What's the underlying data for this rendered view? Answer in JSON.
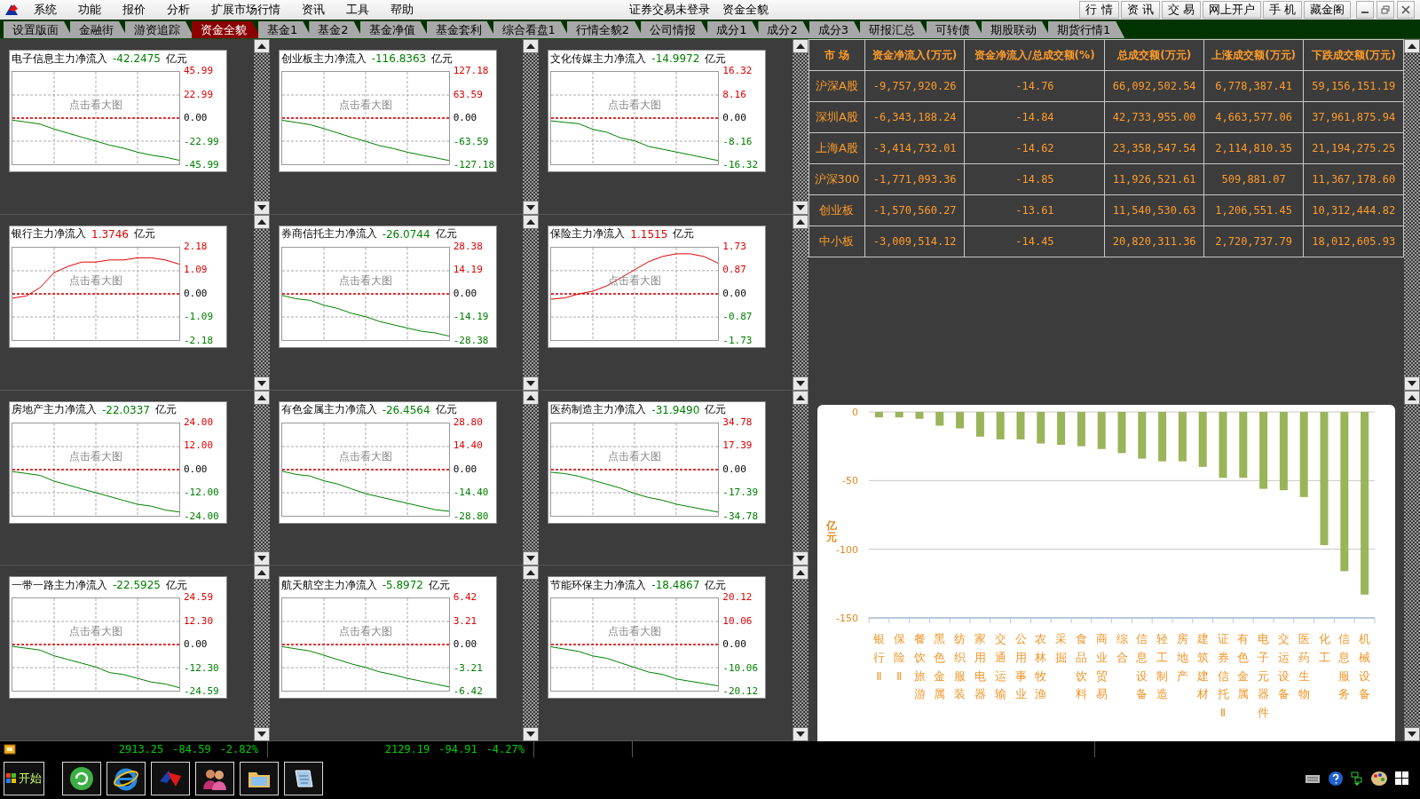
{
  "menu_bar": {
    "items": [
      "系统",
      "功能",
      "报价",
      "分析",
      "扩展市场行情",
      "资讯",
      "工具",
      "帮助"
    ],
    "login_status": "证券交易未登录",
    "page_title": "资金全貌",
    "quick_buttons": [
      "行 情",
      "资 讯",
      "交 易",
      "网上开户",
      "手 机",
      "藏金阁"
    ]
  },
  "tabs": [
    {
      "label": "设置版面",
      "selected": false
    },
    {
      "label": "金融街",
      "selected": false
    },
    {
      "label": "游资追踪",
      "selected": false
    },
    {
      "label": "资金全貌",
      "selected": true
    },
    {
      "label": "基金1",
      "selected": false
    },
    {
      "label": "基金2",
      "selected": false
    },
    {
      "label": "基金净值",
      "selected": false
    },
    {
      "label": "基金套利",
      "selected": false
    },
    {
      "label": "综合看盘1",
      "selected": false
    },
    {
      "label": "行情全貌2",
      "selected": false
    },
    {
      "label": "公司情报",
      "selected": false
    },
    {
      "label": "成分1",
      "selected": false
    },
    {
      "label": "成分2",
      "selected": false
    },
    {
      "label": "成分3",
      "selected": false
    },
    {
      "label": "研报汇总",
      "selected": false
    },
    {
      "label": "可转债",
      "selected": false
    },
    {
      "label": "期股联动",
      "selected": false
    },
    {
      "label": "期货行情1",
      "selected": false
    }
  ],
  "sector_charts": [
    {
      "title": "电子信息主力净流入",
      "value": "-42.2475",
      "unit": "亿元",
      "hint": "点击看大图",
      "chart_data": {
        "type": "line",
        "grid": true,
        "ylim": [
          -45.99,
          45.99
        ],
        "ref_lines": [
          {
            "axis": "y",
            "value": 0,
            "color": "#e00000"
          }
        ],
        "yticks": [
          {
            "value": 45.99,
            "label": "45.99"
          },
          {
            "value": 22.99,
            "label": "22.99"
          },
          {
            "value": 0,
            "label": "0.00"
          },
          {
            "value": -22.99,
            "label": "-22.99"
          },
          {
            "value": -45.99,
            "label": "-45.99"
          }
        ],
        "series": [
          {
            "color": "#008000",
            "values": [
              -2,
              -4,
              -6,
              -11,
              -15,
              -19,
              -23,
              -27,
              -30,
              -34,
              -37,
              -39,
              -42
            ]
          }
        ]
      }
    },
    {
      "title": "创业板主力净流入",
      "value": "-116.8363",
      "unit": "亿元",
      "hint": "点击看大图",
      "chart_data": {
        "type": "line",
        "grid": true,
        "ylim": [
          -127.18,
          127.18
        ],
        "ref_lines": [
          {
            "axis": "y",
            "value": 0,
            "color": "#e00000"
          }
        ],
        "yticks": [
          {
            "value": 127.18,
            "label": "127.18"
          },
          {
            "value": 63.59,
            "label": "63.59"
          },
          {
            "value": 0,
            "label": "0.00"
          },
          {
            "value": -63.59,
            "label": "-63.59"
          },
          {
            "value": -127.18,
            "label": "-127.18"
          }
        ],
        "series": [
          {
            "color": "#008000",
            "values": [
              -6,
              -12,
              -18,
              -29,
              -41,
              -53,
              -64,
              -76,
              -84,
              -94,
              -102,
              -109,
              -117
            ]
          }
        ]
      }
    },
    {
      "title": "文化传媒主力净流入",
      "value": "-14.9972",
      "unit": "亿元",
      "hint": "点击看大图",
      "chart_data": {
        "type": "line",
        "grid": true,
        "ylim": [
          -16.32,
          16.32
        ],
        "ref_lines": [
          {
            "axis": "y",
            "value": 0,
            "color": "#e00000"
          }
        ],
        "yticks": [
          {
            "value": 16.32,
            "label": "16.32"
          },
          {
            "value": 8.16,
            "label": "8.16"
          },
          {
            "value": 0,
            "label": "0.00"
          },
          {
            "value": -8.16,
            "label": "-8.16"
          },
          {
            "value": -16.32,
            "label": "-16.32"
          }
        ],
        "series": [
          {
            "color": "#008000",
            "values": [
              -1,
              -1.5,
              -2,
              -4,
              -5,
              -7,
              -8,
              -10,
              -11,
              -12,
              -13,
              -14,
              -15
            ]
          }
        ]
      }
    },
    {
      "title": "银行主力净流入",
      "value": "1.3746",
      "unit": "亿元",
      "hint": "点击看大图",
      "chart_data": {
        "type": "line",
        "grid": true,
        "ylim": [
          -2.18,
          2.18
        ],
        "ref_lines": [
          {
            "axis": "y",
            "value": 0,
            "color": "#e00000"
          }
        ],
        "yticks": [
          {
            "value": 2.18,
            "label": "2.18"
          },
          {
            "value": 1.09,
            "label": "1.09"
          },
          {
            "value": 0,
            "label": "0.00"
          },
          {
            "value": -1.09,
            "label": "-1.09"
          },
          {
            "value": -2.18,
            "label": "-2.18"
          }
        ],
        "series": [
          {
            "color": "#e00000",
            "values": [
              -0.2,
              -0.1,
              0.3,
              1.0,
              1.3,
              1.5,
              1.5,
              1.6,
              1.6,
              1.7,
              1.7,
              1.6,
              1.4
            ]
          }
        ]
      }
    },
    {
      "title": "券商信托主力净流入",
      "value": "-26.0744",
      "unit": "亿元",
      "hint": "点击看大图",
      "chart_data": {
        "type": "line",
        "grid": true,
        "ylim": [
          -28.38,
          28.38
        ],
        "ref_lines": [
          {
            "axis": "y",
            "value": 0,
            "color": "#e00000"
          }
        ],
        "yticks": [
          {
            "value": 28.38,
            "label": "28.38"
          },
          {
            "value": 14.19,
            "label": "14.19"
          },
          {
            "value": 0,
            "label": "0.00"
          },
          {
            "value": -14.19,
            "label": "-14.19"
          },
          {
            "value": -28.38,
            "label": "-28.38"
          }
        ],
        "series": [
          {
            "color": "#008000",
            "values": [
              -1,
              -3,
              -4,
              -7,
              -9,
              -12,
              -14,
              -17,
              -19,
              -21,
              -23,
              -24,
              -26
            ]
          }
        ]
      }
    },
    {
      "title": "保险主力净流入",
      "value": "1.1515",
      "unit": "亿元",
      "hint": "点击看大图",
      "chart_data": {
        "type": "line",
        "grid": true,
        "ylim": [
          -1.73,
          1.73
        ],
        "ref_lines": [
          {
            "axis": "y",
            "value": 0,
            "color": "#e00000"
          }
        ],
        "yticks": [
          {
            "value": 1.73,
            "label": "1.73"
          },
          {
            "value": 0.87,
            "label": "0.87"
          },
          {
            "value": 0,
            "label": "0.00"
          },
          {
            "value": -0.87,
            "label": "-0.87"
          },
          {
            "value": -1.73,
            "label": "-1.73"
          }
        ],
        "series": [
          {
            "color": "#e00000",
            "values": [
              -0.2,
              -0.15,
              0.0,
              0.1,
              0.3,
              0.6,
              0.9,
              1.2,
              1.4,
              1.5,
              1.5,
              1.4,
              1.15
            ]
          }
        ]
      }
    },
    {
      "title": "房地产主力净流入",
      "value": "-22.0337",
      "unit": "亿元",
      "hint": "点击看大图",
      "chart_data": {
        "type": "line",
        "grid": true,
        "ylim": [
          -24,
          24
        ],
        "ref_lines": [
          {
            "axis": "y",
            "value": 0,
            "color": "#e00000"
          }
        ],
        "yticks": [
          {
            "value": 24,
            "label": "24.00"
          },
          {
            "value": 12,
            "label": "12.00"
          },
          {
            "value": 0,
            "label": "0.00"
          },
          {
            "value": -12,
            "label": "-12.00"
          },
          {
            "value": -24,
            "label": "-24.00"
          }
        ],
        "series": [
          {
            "color": "#008000",
            "values": [
              -1,
              -2,
              -3,
              -6,
              -8,
              -10,
              -12,
              -14,
              -16,
              -18,
              -19,
              -21,
              -22
            ]
          }
        ]
      }
    },
    {
      "title": "有色金属主力净流入",
      "value": "-26.4564",
      "unit": "亿元",
      "hint": "点击看大图",
      "chart_data": {
        "type": "line",
        "grid": true,
        "ylim": [
          -28.8,
          28.8
        ],
        "ref_lines": [
          {
            "axis": "y",
            "value": 0,
            "color": "#e00000"
          }
        ],
        "yticks": [
          {
            "value": 28.8,
            "label": "28.80"
          },
          {
            "value": 14.4,
            "label": "14.40"
          },
          {
            "value": 0,
            "label": "0.00"
          },
          {
            "value": -14.4,
            "label": "-14.40"
          },
          {
            "value": -28.8,
            "label": "-28.80"
          }
        ],
        "series": [
          {
            "color": "#008000",
            "values": [
              -1,
              -3,
              -4,
              -7,
              -9,
              -12,
              -15,
              -17,
              -19,
              -21,
              -23,
              -25,
              -26
            ]
          }
        ]
      }
    },
    {
      "title": "医药制造主力净流入",
      "value": "-31.9490",
      "unit": "亿元",
      "hint": "点击看大图",
      "chart_data": {
        "type": "line",
        "grid": true,
        "ylim": [
          -34.78,
          34.78
        ],
        "ref_lines": [
          {
            "axis": "y",
            "value": 0,
            "color": "#e00000"
          }
        ],
        "yticks": [
          {
            "value": 34.78,
            "label": "34.78"
          },
          {
            "value": 17.39,
            "label": "17.39"
          },
          {
            "value": 0,
            "label": "0.00"
          },
          {
            "value": -17.39,
            "label": "-17.39"
          },
          {
            "value": -34.78,
            "label": "-34.78"
          }
        ],
        "series": [
          {
            "color": "#008000",
            "values": [
              -2,
              -3,
              -5,
              -8,
              -11,
              -14,
              -18,
              -21,
              -23,
              -26,
              -28,
              -30,
              -32
            ]
          }
        ]
      }
    },
    {
      "title": "一带一路主力净流入",
      "value": "-22.5925",
      "unit": "亿元",
      "hint": "点击看大图",
      "chart_data": {
        "type": "line",
        "grid": true,
        "ylim": [
          -24.59,
          24.59
        ],
        "ref_lines": [
          {
            "axis": "y",
            "value": 0,
            "color": "#e00000"
          }
        ],
        "yticks": [
          {
            "value": 24.59,
            "label": "24.59"
          },
          {
            "value": 12.3,
            "label": "12.30"
          },
          {
            "value": 0,
            "label": "0.00"
          },
          {
            "value": -12.3,
            "label": "-12.30"
          },
          {
            "value": -24.59,
            "label": "-24.59"
          }
        ],
        "series": [
          {
            "color": "#008000",
            "values": [
              -1,
              -2,
              -3,
              -6,
              -8,
              -10,
              -12,
              -15,
              -16,
              -18,
              -20,
              -21,
              -23
            ]
          }
        ]
      }
    },
    {
      "title": "航天航空主力净流入",
      "value": "-5.8972",
      "unit": "亿元",
      "hint": "点击看大图",
      "chart_data": {
        "type": "line",
        "grid": true,
        "ylim": [
          -6.42,
          6.42
        ],
        "ref_lines": [
          {
            "axis": "y",
            "value": 0,
            "color": "#e00000"
          }
        ],
        "yticks": [
          {
            "value": 6.42,
            "label": "6.42"
          },
          {
            "value": 3.21,
            "label": "3.21"
          },
          {
            "value": 0,
            "label": "0.00"
          },
          {
            "value": -3.21,
            "label": "-3.21"
          },
          {
            "value": -6.42,
            "label": "-6.42"
          }
        ],
        "series": [
          {
            "color": "#008000",
            "values": [
              -0.3,
              -0.6,
              -0.9,
              -1.5,
              -2.1,
              -2.7,
              -3.2,
              -3.8,
              -4.2,
              -4.7,
              -5.1,
              -5.5,
              -5.9
            ]
          }
        ]
      }
    },
    {
      "title": "节能环保主力净流入",
      "value": "-18.4867",
      "unit": "亿元",
      "hint": "点击看大图",
      "chart_data": {
        "type": "line",
        "grid": true,
        "ylim": [
          -20.12,
          20.12
        ],
        "ref_lines": [
          {
            "axis": "y",
            "value": 0,
            "color": "#e00000"
          }
        ],
        "yticks": [
          {
            "value": 20.12,
            "label": "20.12"
          },
          {
            "value": 10.06,
            "label": "10.06"
          },
          {
            "value": 0,
            "label": "0.00"
          },
          {
            "value": -10.06,
            "label": "-10.06"
          },
          {
            "value": -20.12,
            "label": "-20.12"
          }
        ],
        "series": [
          {
            "color": "#008000",
            "values": [
              -1,
              -2,
              -3,
              -5,
              -6,
              -8,
              -10,
              -12,
              -13,
              -15,
              -16,
              -17,
              -18
            ]
          }
        ]
      }
    }
  ],
  "market_table": {
    "columns": [
      "市 场",
      "资金净流入(万元)",
      "资金净流入/总成交额(%)",
      "总成交额(万元)",
      "上涨成交额(万元)",
      "下跌成交额(万元)"
    ],
    "rows": [
      [
        "沪深A股",
        "-9,757,920.26",
        "-14.76",
        "66,092,502.54",
        "6,778,387.41",
        "59,156,151.19"
      ],
      [
        "深圳A股",
        "-6,343,188.24",
        "-14.84",
        "42,733,955.00",
        "4,663,577.06",
        "37,961,875.94"
      ],
      [
        "上海A股",
        "-3,414,732.01",
        "-14.62",
        "23,358,547.54",
        "2,114,810.35",
        "21,194,275.25"
      ],
      [
        "沪深300",
        "-1,771,093.36",
        "-14.85",
        "11,926,521.61",
        "509,881.07",
        "11,367,178.60"
      ],
      [
        "创业板",
        "-1,570,560.27",
        "-13.61",
        "11,540,530.63",
        "1,206,551.45",
        "10,312,444.82"
      ],
      [
        "中小板",
        "-3,009,514.12",
        "-14.45",
        "20,820,311.36",
        "2,720,737.79",
        "18,012,605.93"
      ]
    ]
  },
  "industry_chart": {
    "chart_data": {
      "type": "bar",
      "ylabel": "亿元",
      "ylim": [
        -150,
        0
      ],
      "yticks": [
        0,
        -50,
        -100,
        -150
      ],
      "categories": [
        "银行Ⅱ",
        "保险Ⅱ",
        "餐饮旅游",
        "黑色金属",
        "纺织服装",
        "家用电器",
        "交通运输",
        "公用事业",
        "农林牧渔",
        "采掘",
        "食品饮料",
        "商业贸易",
        "综合",
        "信息设备",
        "轻工制造",
        "房地产",
        "建筑建材",
        "证券信托Ⅱ",
        "有色金属",
        "电子元器件",
        "交运设备",
        "医药生物",
        "化工",
        "信息服务",
        "机械设备"
      ],
      "values": [
        -4,
        -4,
        -5,
        -10,
        -12,
        -18,
        -20,
        -20,
        -23,
        -24,
        -25,
        -27,
        -30,
        -34,
        -36,
        -36,
        -40,
        -48,
        -48,
        -56,
        -57,
        -62,
        -97,
        -116,
        -133
      ]
    }
  },
  "status_bar": {
    "quotes": [
      {
        "price": "2913.25",
        "change": "-84.59",
        "percent": "-2.82%"
      },
      {
        "price": "2129.19",
        "change": "-94.91",
        "percent": "-4.27%"
      }
    ]
  },
  "taskbar": {
    "start_label": "开始"
  }
}
